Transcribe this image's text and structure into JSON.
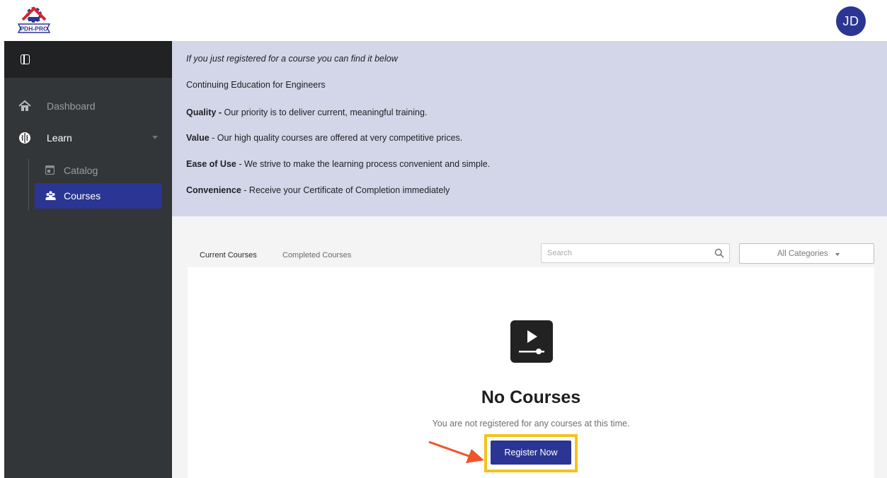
{
  "header": {
    "logo_text": "PDH-PRO",
    "avatar_initials": "JD"
  },
  "sidebar": {
    "items": [
      {
        "label": "Dashboard",
        "icon": "home-icon"
      },
      {
        "label": "Learn",
        "icon": "brain-icon"
      }
    ],
    "sub_items": [
      {
        "label": "Catalog",
        "icon": "catalog-icon"
      },
      {
        "label": "Courses",
        "icon": "courses-icon",
        "active": true
      }
    ]
  },
  "banner": {
    "intro": "If you just registered for a course you can find it below",
    "heading": "Continuing Education for Engineers",
    "lines": [
      {
        "bold": "Quality - ",
        "text": "Our priority is to deliver current, meaningful training."
      },
      {
        "bold": "Value",
        "text": " - Our high quality courses are offered at very competitive prices."
      },
      {
        "bold": "Ease of Use",
        "text": " - We strive to make the learning process convenient and simple."
      },
      {
        "bold": "Convenience",
        "text": " - Receive your Certificate of Completion immediately"
      }
    ]
  },
  "tabs": [
    {
      "label": "Current Courses",
      "active": true
    },
    {
      "label": "Completed Courses",
      "active": false
    }
  ],
  "search": {
    "placeholder": "Search",
    "value": ""
  },
  "category_filter": {
    "selected": "All Categories"
  },
  "empty_state": {
    "title": "No Courses",
    "message": "You are not registered for any courses at this time.",
    "button_label": "Register Now"
  },
  "colors": {
    "accent": "#2b3593",
    "banner_bg": "#d3d5e8",
    "sidebar_bg": "#333638",
    "highlight": "#f6c21b",
    "arrow": "#f0542b"
  }
}
